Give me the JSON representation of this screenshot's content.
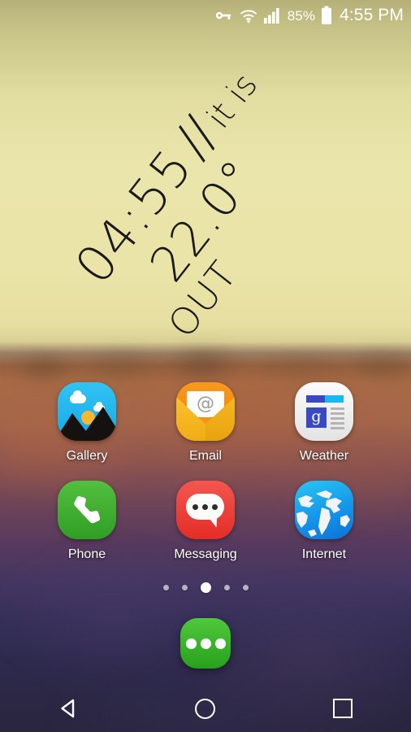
{
  "status_bar": {
    "icons": [
      "vpn-key-icon",
      "wifi-icon",
      "signal-bars-icon",
      "battery-icon"
    ],
    "battery_percent": "85%",
    "time": "4:55 PM"
  },
  "widget": {
    "type": "clock-weather-widget",
    "time": "04:55",
    "separator": "//",
    "it_is": "it is",
    "temperature": "22.0°",
    "location_word": "OUT",
    "rotation_deg": -52
  },
  "app_grid": {
    "rows": [
      {
        "apps": [
          {
            "label": "Gallery",
            "icon": "gallery-icon",
            "color": "#13a9ea"
          },
          {
            "label": "Email",
            "icon": "email-icon",
            "color": "#f58a12"
          },
          {
            "label": "Weather",
            "icon": "weather-icon",
            "color": "#e3e3e3"
          }
        ]
      },
      {
        "apps": [
          {
            "label": "Phone",
            "icon": "phone-icon",
            "color": "#2f9e23"
          },
          {
            "label": "Messaging",
            "icon": "messaging-icon",
            "color": "#e32d26"
          },
          {
            "label": "Internet",
            "icon": "internet-icon",
            "color": "#1596ea"
          }
        ]
      }
    ]
  },
  "page_indicator": {
    "total": 5,
    "active_index": 2
  },
  "app_drawer": {
    "icon": "app-drawer-icon",
    "color": "#27a01c"
  },
  "nav_bar": {
    "back": "back-button",
    "home": "home-button",
    "recents": "recents-button"
  },
  "colors": {
    "sky_top": "#b4b077",
    "sky_mid": "#eae5ab",
    "horizon": "#97603f",
    "ground_low": "#453662",
    "ground_bottom": "#2a2640",
    "text_light": "#ffffff",
    "widget_text": "#191919"
  }
}
